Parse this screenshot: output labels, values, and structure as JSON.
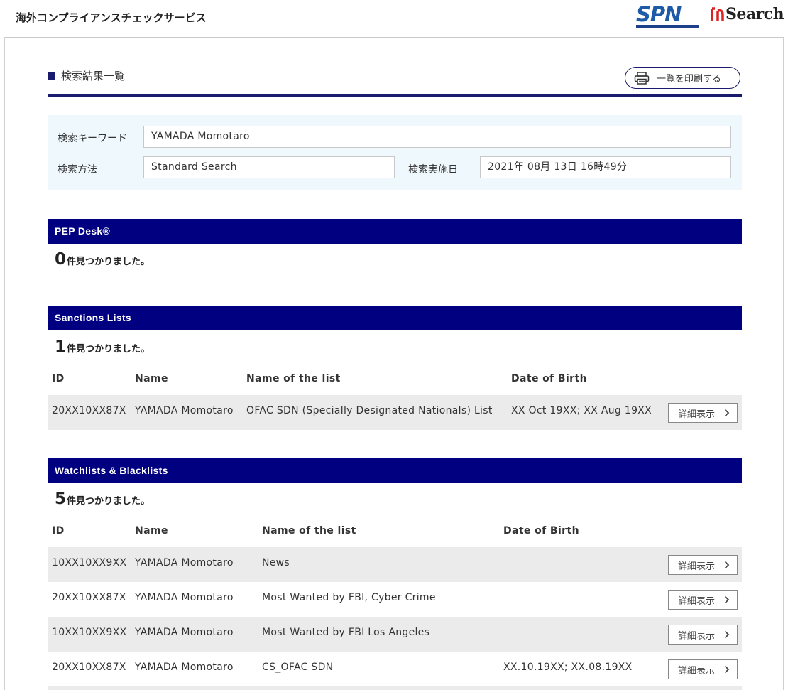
{
  "header": {
    "app_title": "海外コンプライアンスチェックサービス",
    "logo_spn": "SPN",
    "logo_search": "Search"
  },
  "page": {
    "section_title": "検索結果一覧",
    "print_label": "一覧を印刷する"
  },
  "criteria": {
    "keyword_label": "検索キーワード",
    "keyword_value": "YAMADA Momotaro",
    "method_label": "検索方法",
    "method_value": "Standard Search",
    "date_label": "検索実施日",
    "date_value": "2021年 08月 13日 16時49分"
  },
  "sections": {
    "pep": {
      "title": "PEP Desk®",
      "count": "0",
      "count_suffix": "件見つかりました。"
    },
    "sanctions": {
      "title": "Sanctions Lists",
      "count": "1",
      "count_suffix": "件見つかりました。",
      "columns": [
        "ID",
        "Name",
        "Name of the list",
        "Date of Birth"
      ],
      "rows": [
        {
          "id": "20XX10XX87X",
          "name": "YAMADA Momotaro",
          "list": "OFAC SDN (Specially Designated Nationals) List",
          "dob": "XX Oct 19XX; XX Aug 19XX",
          "button": "詳細表示"
        }
      ]
    },
    "watchlists": {
      "title": "Watchlists & Blacklists",
      "count": "5",
      "count_suffix": "件見つかりました。",
      "columns": [
        "ID",
        "Name",
        "Name of the list",
        "Date of Birth"
      ],
      "rows": [
        {
          "id": "10XX10XX9XX",
          "name": "YAMADA Momotaro",
          "list": "News",
          "dob": "",
          "button": "詳細表示"
        },
        {
          "id": "20XX10XX87X",
          "name": "YAMADA Momotaro",
          "list": "Most Wanted by FBI, Cyber Crime",
          "dob": "",
          "button": "詳細表示"
        },
        {
          "id": "10XX10XX9XX",
          "name": "YAMADA Momotaro",
          "list": "Most Wanted by FBI Los Angeles",
          "dob": "",
          "button": "詳細表示"
        },
        {
          "id": "20XX10XX87X",
          "name": "YAMADA Momotaro",
          "list": "CS_OFAC SDN",
          "dob": "XX.10.19XX; XX.08.19XX",
          "button": "詳細表示"
        }
      ]
    }
  },
  "colors": {
    "header_bar": "#000080",
    "accent": "#1a1a6e",
    "criteria_bg": "#eef8fd",
    "row_shade": "#ebebeb"
  }
}
